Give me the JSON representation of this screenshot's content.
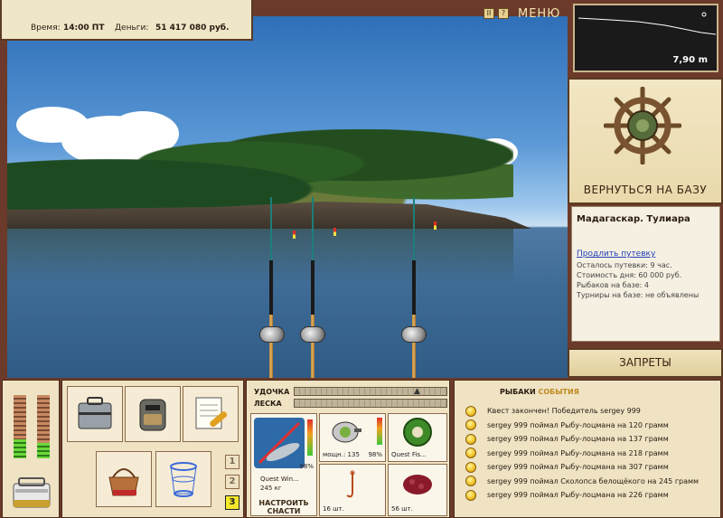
{
  "top": {
    "time_label": "Время:",
    "time_value": "14:00 ПТ",
    "money_label": "Деньги:",
    "money_value": "51 417 080 руб.",
    "pause_glyph": "II",
    "help_glyph": "?",
    "menu_label": "МЕНЮ"
  },
  "depth": {
    "value": "7,90 m"
  },
  "base": {
    "return_label": "ВЕРНУТЬСЯ НА БАЗУ",
    "location": "Мадагаскар. Тулиара",
    "extend_link": "Продлить путевку",
    "lines": [
      "Осталось путевки: 9 час.",
      "Стоимость дня: 60 000 руб.",
      "Рыбаков на базе: 4",
      "Турниры на базе: не объявлены"
    ],
    "bans_label": "ЗАПРЕТЫ"
  },
  "gauges": {
    "left_level": 0.3,
    "right_level": 0.25
  },
  "rod_select": {
    "buttons": [
      "1",
      "2",
      "3"
    ],
    "active": "3"
  },
  "tackle": {
    "rod_label": "УДОЧКА",
    "line_label": "ЛЕСКА",
    "rod_name": "Quest Win...",
    "rod_weight": "245 кг",
    "rod_pct": "98%",
    "reel_cap": "мощн.: 135",
    "reel_pct": "98%",
    "line_name": "Quest Fis...",
    "hook_count": "16 шт.",
    "bait_count": "56 шт.",
    "setup_label_1": "НАСТРОИТЬ",
    "setup_label_2": "СНАСТИ"
  },
  "events": {
    "tab_fishers": "РЫБАКИ",
    "tab_events": "СОБЫТИЯ",
    "items": [
      "Квест закончен! Победитель sergey 999",
      "sergey 999 поймал Рыбу-лоцмана на 120 грамм",
      "sergey 999 поймал Рыбу-лоцмана на 137 грамм",
      "sergey 999 поймал Рыбу-лоцмана на 218 грамм",
      "sergey 999 поймал Рыбу-лоцмана на 307 грамм",
      "sergey 999 поймал Сколопса белощёкого на 245 грамм",
      "sergey 999 поймал Рыбу-лоцмана на 226 грамм"
    ]
  }
}
